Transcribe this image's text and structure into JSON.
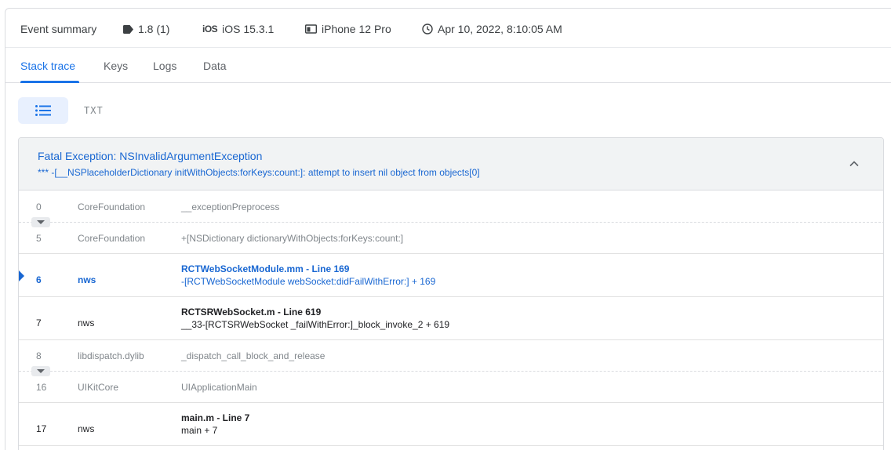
{
  "summary": {
    "title": "Event summary",
    "version": "1.8 (1)",
    "os_badge": "iOS",
    "os": "iOS 15.3.1",
    "device": "iPhone 12 Pro",
    "timestamp": "Apr 10, 2022, 8:10:05 AM"
  },
  "tabs": [
    "Stack trace",
    "Keys",
    "Logs",
    "Data"
  ],
  "view_toggle": {
    "txt_label": "TXT"
  },
  "exception": {
    "title": "Fatal Exception: NSInvalidArgumentException",
    "message": "*** -[__NSPlaceholderDictionary initWithObjects:forKeys:count:]: attempt to insert nil object from objects[0]"
  },
  "frames": [
    {
      "num": "0",
      "lib": "CoreFoundation",
      "symbol": "__exceptionPreprocess"
    },
    {
      "num": "5",
      "lib": "CoreFoundation",
      "symbol": "+[NSDictionary dictionaryWithObjects:forKeys:count:]"
    },
    {
      "num": "6",
      "lib": "nws",
      "file": "RCTWebSocketModule.mm - Line 169",
      "symbol": "-[RCTWebSocketModule webSocket:didFailWithError:] + 169"
    },
    {
      "num": "7",
      "lib": "nws",
      "file": "RCTSRWebSocket.m - Line 619",
      "symbol": "__33-[RCTSRWebSocket _failWithError:]_block_invoke_2 + 619"
    },
    {
      "num": "8",
      "lib": "libdispatch.dylib",
      "symbol": "_dispatch_call_block_and_release"
    },
    {
      "num": "16",
      "lib": "UIKitCore",
      "symbol": "UIApplicationMain"
    },
    {
      "num": "17",
      "lib": "nws",
      "file": "main.m - Line 7",
      "symbol": "main + 7"
    }
  ],
  "colors": {
    "accent": "#1a73e8",
    "highlight_text": "#1967d2",
    "muted": "#80868b"
  }
}
